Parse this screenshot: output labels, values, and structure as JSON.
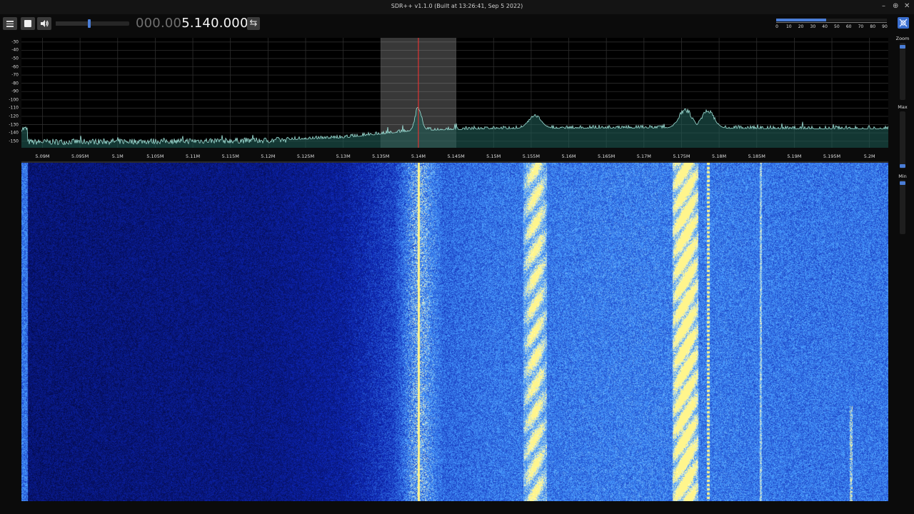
{
  "window": {
    "title": "SDR++ v1.1.0 (Built at 13:26:41, Sep  5 2022)",
    "controls": [
      "–",
      "⊕",
      "✕"
    ]
  },
  "toolbar": {
    "menu_icon": "hamburger-menu-icon",
    "stop_icon": "stop-icon",
    "volume_icon": "speaker-icon",
    "volume_level": 0.46,
    "frequency_dim": "000.00",
    "frequency_main": "5.140.000",
    "swap_label": "⇆",
    "snr_level": 0.45,
    "snr_ticks": [
      "0",
      "10",
      "20",
      "30",
      "40",
      "50",
      "60",
      "70",
      "80",
      "90"
    ],
    "settings_icon": "settings-icon"
  },
  "side_panel": {
    "zoom_label": "Zoom",
    "max_label": "Max",
    "min_label": "Min",
    "zoom_level": 0.96,
    "max_level": 0.02,
    "min_level": 0.97
  },
  "colors": {
    "accent": "#4a7dd6",
    "fft_line": "#9fe0d7",
    "fft_fill": "#1f5b55",
    "waterfall_bg": "#02063a",
    "vfo_marker": "#ff3030"
  },
  "chart_data": {
    "type": "line",
    "title": "",
    "xlabel": "",
    "ylabel": "",
    "y_ticks": [
      "-30",
      "-40",
      "-50",
      "-60",
      "-70",
      "-80",
      "-90",
      "-100",
      "-110",
      "-120",
      "-130",
      "-140",
      "-150"
    ],
    "ylim": [
      -158,
      -25
    ],
    "x_ticks": [
      "5.09M",
      "5.095M",
      "5.1M",
      "5.105M",
      "5.11M",
      "5.115M",
      "5.12M",
      "5.125M",
      "5.13M",
      "5.135M",
      "5.14M",
      "5.145M",
      "5.15M",
      "5.155M",
      "5.16M",
      "5.165M",
      "5.17M",
      "5.175M",
      "5.18M",
      "5.185M",
      "5.19M",
      "5.195M",
      "5.2M"
    ],
    "x_tick_values": [
      5.09,
      5.095,
      5.1,
      5.105,
      5.11,
      5.115,
      5.12,
      5.125,
      5.13,
      5.135,
      5.14,
      5.145,
      5.15,
      5.155,
      5.16,
      5.165,
      5.17,
      5.175,
      5.18,
      5.185,
      5.19,
      5.195,
      5.2
    ],
    "xlim": [
      5.0872,
      5.2025
    ],
    "vfo_center": 5.14,
    "vfo_band": [
      5.135,
      5.145
    ],
    "signals": [
      {
        "freq": 5.14,
        "peak": -106
      },
      {
        "freq": 5.1555,
        "peak": -118
      },
      {
        "freq": 5.1755,
        "peak": -110
      },
      {
        "freq": 5.1785,
        "peak": -112
      }
    ],
    "noise_floor": [
      {
        "x": 5.088,
        "y": -151
      },
      {
        "x": 5.12,
        "y": -149
      },
      {
        "x": 5.13,
        "y": -146
      },
      {
        "x": 5.14,
        "y": -137
      },
      {
        "x": 5.15,
        "y": -135
      },
      {
        "x": 5.17,
        "y": -134
      },
      {
        "x": 5.19,
        "y": -135
      },
      {
        "x": 5.202,
        "y": -135
      }
    ]
  }
}
